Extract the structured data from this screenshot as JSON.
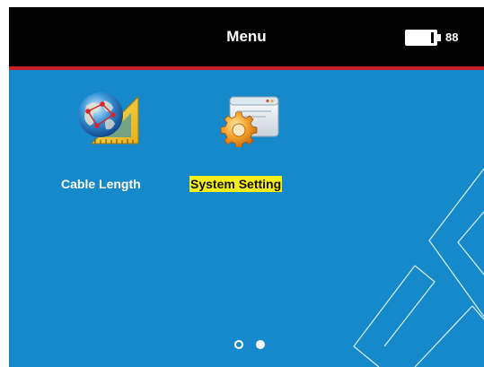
{
  "header": {
    "title": "Menu",
    "battery_level": 88,
    "battery_text": "88"
  },
  "apps": [
    {
      "label": "Cable Length",
      "icon": "globe-ruler-icon",
      "selected": false
    },
    {
      "label": "System Setting",
      "icon": "settings-gear-icon",
      "selected": true
    }
  ],
  "pager": {
    "page_count": 2,
    "current_page": 2
  },
  "colors": {
    "background": "#1589c9",
    "header": "#020202",
    "header_accent": "#c8202a",
    "selection_highlight": "#f4ee1b",
    "text": "#ffffff"
  }
}
